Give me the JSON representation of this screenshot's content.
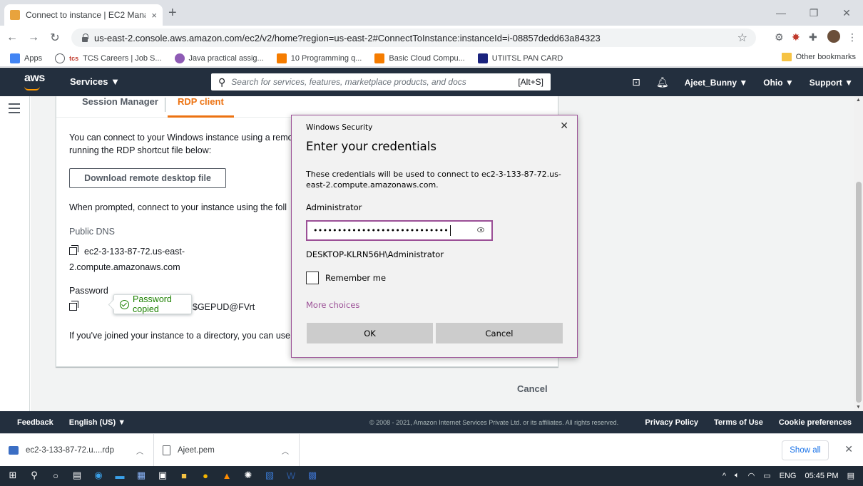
{
  "browser": {
    "tab_title": "Connect to instance | EC2 Manag",
    "tab_close": "×",
    "new_tab": "+",
    "url": "us-east-2.console.aws.amazon.com/ec2/v2/home?region=us-east-2#ConnectToInstance:instanceId=i-08857dedd63a84323",
    "bookmarks": [
      "Apps",
      "TCS Careers | Job S...",
      "Java practical assig...",
      "10 Programming q...",
      "Basic Cloud Compu...",
      "UTIITSL PAN CARD"
    ],
    "other_bookmarks": "Other bookmarks"
  },
  "aws_nav": {
    "logo": "aws",
    "services": "Services ▼",
    "search_placeholder": "Search for services, features, marketplace products, and docs",
    "search_shortcut": "[Alt+S]",
    "user": "Ajeet_Bunny ▼",
    "region": "Ohio ▼",
    "support": "Support ▼"
  },
  "panel": {
    "tabs": [
      "Session Manager",
      "RDP client"
    ],
    "intro_line1": "You can connect to your Windows instance using a remo",
    "intro_line2": "running the RDP shortcut file below:",
    "download_button": "Download remote desktop file",
    "prompt_text": "When prompted, connect to your instance using the foll",
    "public_dns_label": "Public DNS",
    "public_dns_line1": "ec2-3-133-87-72.us-east-",
    "public_dns_line2": "2.compute.amazonaws.com",
    "password_label": "Password",
    "password_copied": "Password copied",
    "password_tail": "$GEPUD@FVrt",
    "directory_text": "If you've joined your instance to a directory, you can use",
    "cancel": "Cancel"
  },
  "dialog": {
    "title": "Windows Security",
    "close": "✕",
    "heading": "Enter your credentials",
    "description": "These credentials will be used to connect to ec2-3-133-87-72.us-east-2.compute.amazonaws.com.",
    "username": "Administrator",
    "password_mask": "••••••••••••••••••••••••••••",
    "domain_user": "DESKTOP-KLRN56H\\Administrator",
    "remember_me": "Remember me",
    "more_choices": "More choices",
    "ok": "OK",
    "cancel": "Cancel"
  },
  "footer": {
    "feedback": "Feedback",
    "language": "English (US) ▼",
    "copyright": "© 2008 - 2021, Amazon Internet Services Private Ltd. or its affiliates. All rights reserved.",
    "privacy": "Privacy Policy",
    "terms": "Terms of Use",
    "cookies": "Cookie preferences"
  },
  "downloads": {
    "item1": "ec2-3-133-87-72.u....rdp",
    "item2": "Ajeet.pem",
    "show_all": "Show all",
    "close": "✕"
  },
  "taskbar": {
    "language": "ENG",
    "time": "05:45 PM"
  },
  "colors": {
    "aws_dark": "#232f3e",
    "aws_orange": "#ec7211",
    "dialog_accent": "#9b4f96",
    "success_green": "#1d8102"
  }
}
